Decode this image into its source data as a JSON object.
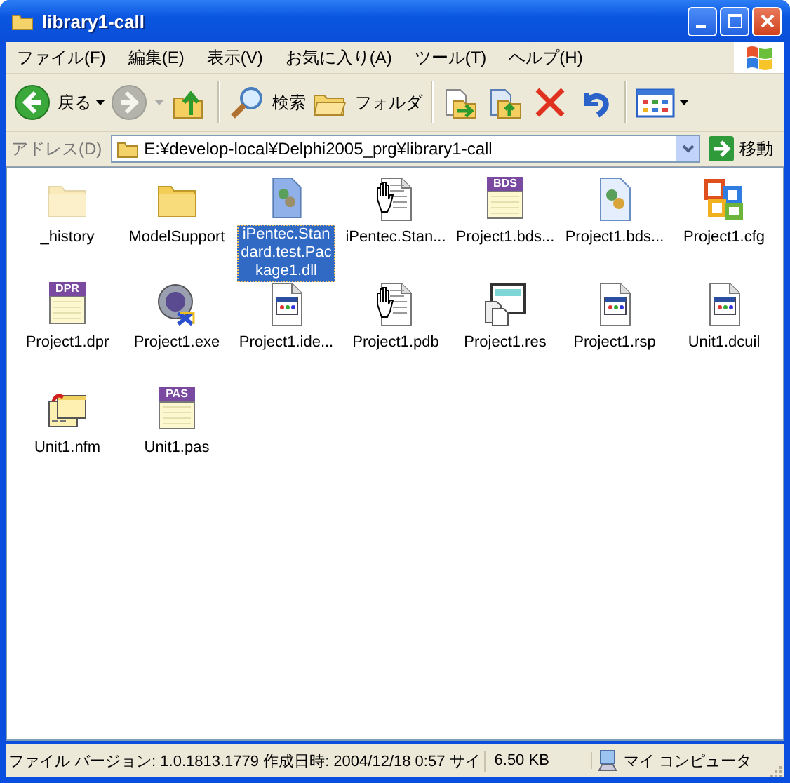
{
  "window": {
    "title": "library1-call"
  },
  "menu": [
    "ファイル(F)",
    "編集(E)",
    "表示(V)",
    "お気に入り(A)",
    "ツール(T)",
    "ヘルプ(H)"
  ],
  "toolbar": [
    [
      {
        "kind": "back",
        "label": "戻る",
        "disabled": false,
        "has_menu": true
      },
      {
        "kind": "forward",
        "disabled": true,
        "has_menu": true
      },
      {
        "kind": "up",
        "disabled": false,
        "has_menu": false
      }
    ],
    [
      {
        "kind": "search",
        "label": "検索",
        "disabled": false,
        "has_menu": false
      },
      {
        "kind": "folders",
        "label": "フォルダ",
        "disabled": false,
        "has_menu": false
      }
    ],
    [
      {
        "kind": "move",
        "disabled": false,
        "has_menu": false
      },
      {
        "kind": "copy",
        "disabled": false,
        "has_menu": false
      },
      {
        "kind": "delete",
        "disabled": false,
        "has_menu": false
      },
      {
        "kind": "undo",
        "disabled": false,
        "has_menu": false
      }
    ],
    [
      {
        "kind": "views",
        "disabled": false,
        "has_menu": true
      }
    ]
  ],
  "address": {
    "label": "アドレス(D)",
    "value": "E:¥develop-local¥Delphi2005_prg¥library1-call",
    "go": "移動"
  },
  "files": [
    {
      "name": "_history",
      "kind": "folder",
      "hidden": true,
      "selected": false
    },
    {
      "name": "ModelSupport",
      "kind": "folder",
      "hidden": false,
      "selected": false
    },
    {
      "name": "iPentec.Standard.test.Package1.dll",
      "kind": "dll",
      "selected": true
    },
    {
      "name": "iPentec.Stan...",
      "kind": "hand",
      "selected": false
    },
    {
      "name": "Project1.bds...",
      "kind": "badge",
      "badge": "BDS",
      "selected": false
    },
    {
      "name": "Project1.bds...",
      "kind": "script",
      "selected": false
    },
    {
      "name": "Project1.cfg",
      "kind": "cfg",
      "selected": false
    },
    {
      "name": "Project1.dpr",
      "kind": "badge",
      "badge": "DPR",
      "selected": false
    },
    {
      "name": "Project1.exe",
      "kind": "exe",
      "selected": false
    },
    {
      "name": "Project1.ide...",
      "kind": "window",
      "selected": false
    },
    {
      "name": "Project1.pdb",
      "kind": "hand",
      "selected": false
    },
    {
      "name": "Project1.res",
      "kind": "res",
      "selected": false
    },
    {
      "name": "Project1.rsp",
      "kind": "window",
      "selected": false
    },
    {
      "name": "Unit1.dcuil",
      "kind": "window",
      "selected": false
    },
    {
      "name": "Unit1.nfm",
      "kind": "form",
      "selected": false
    },
    {
      "name": "Unit1.pas",
      "kind": "badge",
      "badge": "PAS",
      "selected": false
    }
  ],
  "status_bar": {
    "text": "ファイル バージョン: 1.0.1813.1779 作成日時: 2004/12/18 0:57 サイ",
    "size": "6.50 KB",
    "zone": "マイ コンピュータ"
  }
}
